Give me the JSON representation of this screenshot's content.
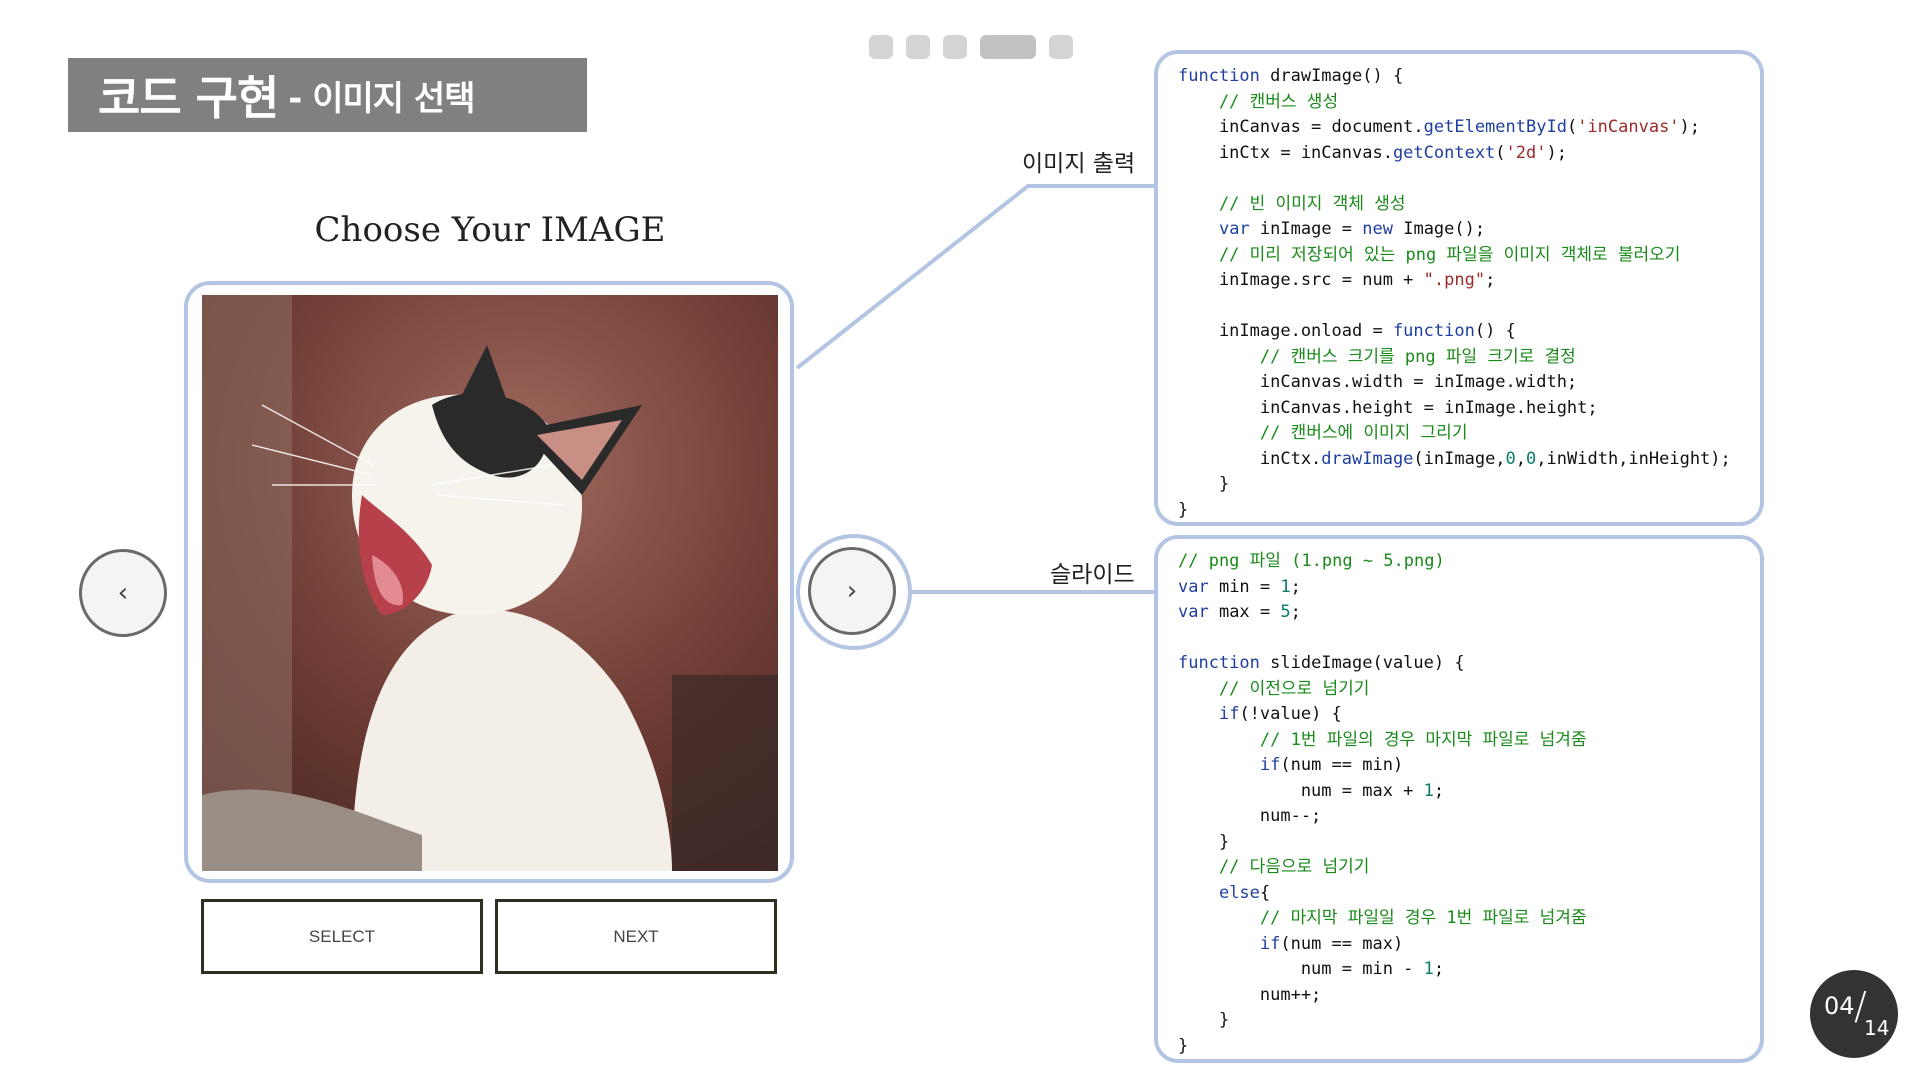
{
  "header": {
    "title_main": "코드 구현",
    "title_sub": "- 이미지 선택"
  },
  "pager": {
    "total_dots": 5,
    "active_index": 3
  },
  "viewer": {
    "heading": "Choose Your IMAGE",
    "prev_symbol": "‹",
    "next_symbol": "›",
    "select_label": "SELECT",
    "next_label": "NEXT"
  },
  "connectors": {
    "output_label": "이미지 출력",
    "slide_label": "슬라이드"
  },
  "code_top": [
    [
      {
        "t": "function",
        "c": "kw"
      },
      {
        "t": " drawImage() {",
        "c": ""
      }
    ],
    [
      {
        "t": "    // 캔버스 생성",
        "c": "cmt"
      }
    ],
    [
      {
        "t": "    inCanvas = document.",
        "c": ""
      },
      {
        "t": "getElementById",
        "c": "fn"
      },
      {
        "t": "(",
        "c": ""
      },
      {
        "t": "'inCanvas'",
        "c": "str"
      },
      {
        "t": ");",
        "c": ""
      }
    ],
    [
      {
        "t": "    inCtx = inCanvas.",
        "c": ""
      },
      {
        "t": "getContext",
        "c": "fn"
      },
      {
        "t": "(",
        "c": ""
      },
      {
        "t": "'2d'",
        "c": "str"
      },
      {
        "t": ");",
        "c": ""
      }
    ],
    [
      {
        "t": "",
        "c": ""
      }
    ],
    [
      {
        "t": "    // 빈 이미지 객체 생성",
        "c": "cmt"
      }
    ],
    [
      {
        "t": "    ",
        "c": ""
      },
      {
        "t": "var",
        "c": "kw"
      },
      {
        "t": " inImage = ",
        "c": ""
      },
      {
        "t": "new",
        "c": "kw"
      },
      {
        "t": " Image();",
        "c": ""
      }
    ],
    [
      {
        "t": "    // 미리 저장되어 있는 png 파일을 이미지 객체로 불러오기",
        "c": "cmt"
      }
    ],
    [
      {
        "t": "    inImage.src = num + ",
        "c": ""
      },
      {
        "t": "\".png\"",
        "c": "str"
      },
      {
        "t": ";",
        "c": ""
      }
    ],
    [
      {
        "t": "",
        "c": ""
      }
    ],
    [
      {
        "t": "    inImage.onload = ",
        "c": ""
      },
      {
        "t": "function",
        "c": "kw"
      },
      {
        "t": "() {",
        "c": ""
      }
    ],
    [
      {
        "t": "        // 캔버스 크기를 png 파일 크기로 결정",
        "c": "cmt"
      }
    ],
    [
      {
        "t": "        inCanvas.width = inImage.width;",
        "c": ""
      }
    ],
    [
      {
        "t": "        inCanvas.height = inImage.height;",
        "c": ""
      }
    ],
    [
      {
        "t": "        // 캔버스에 이미지 그리기",
        "c": "cmt"
      }
    ],
    [
      {
        "t": "        inCtx.",
        "c": ""
      },
      {
        "t": "drawImage",
        "c": "fn"
      },
      {
        "t": "(inImage,",
        "c": ""
      },
      {
        "t": "0",
        "c": "num"
      },
      {
        "t": ",",
        "c": ""
      },
      {
        "t": "0",
        "c": "num"
      },
      {
        "t": ",inWidth,inHeight);",
        "c": ""
      }
    ],
    [
      {
        "t": "    }",
        "c": ""
      }
    ],
    [
      {
        "t": "}",
        "c": ""
      }
    ]
  ],
  "code_bottom": [
    [
      {
        "t": "// png 파일 (1.png ~ 5.png)",
        "c": "cmt"
      }
    ],
    [
      {
        "t": "var",
        "c": "kw"
      },
      {
        "t": " min = ",
        "c": ""
      },
      {
        "t": "1",
        "c": "num"
      },
      {
        "t": ";",
        "c": ""
      }
    ],
    [
      {
        "t": "var",
        "c": "kw"
      },
      {
        "t": " max = ",
        "c": ""
      },
      {
        "t": "5",
        "c": "num"
      },
      {
        "t": ";",
        "c": ""
      }
    ],
    [
      {
        "t": "",
        "c": ""
      }
    ],
    [
      {
        "t": "function",
        "c": "kw"
      },
      {
        "t": " slideImage(value) {",
        "c": ""
      }
    ],
    [
      {
        "t": "    // 이전으로 넘기기",
        "c": "cmt"
      }
    ],
    [
      {
        "t": "    ",
        "c": ""
      },
      {
        "t": "if",
        "c": "kw"
      },
      {
        "t": "(!value) {",
        "c": ""
      }
    ],
    [
      {
        "t": "        // 1번 파일의 경우 마지막 파일로 넘겨줌",
        "c": "cmt"
      }
    ],
    [
      {
        "t": "        ",
        "c": ""
      },
      {
        "t": "if",
        "c": "kw"
      },
      {
        "t": "(num == min)",
        "c": ""
      }
    ],
    [
      {
        "t": "            num = max + ",
        "c": ""
      },
      {
        "t": "1",
        "c": "num"
      },
      {
        "t": ";",
        "c": ""
      }
    ],
    [
      {
        "t": "        num--;",
        "c": ""
      }
    ],
    [
      {
        "t": "    }",
        "c": ""
      }
    ],
    [
      {
        "t": "    // 다음으로 넘기기",
        "c": "cmt"
      }
    ],
    [
      {
        "t": "    ",
        "c": ""
      },
      {
        "t": "else",
        "c": "kw"
      },
      {
        "t": "{",
        "c": ""
      }
    ],
    [
      {
        "t": "        // 마지막 파일일 경우 1번 파일로 넘겨줌",
        "c": "cmt"
      }
    ],
    [
      {
        "t": "        ",
        "c": ""
      },
      {
        "t": "if",
        "c": "kw"
      },
      {
        "t": "(num == max)",
        "c": ""
      }
    ],
    [
      {
        "t": "            num = min - ",
        "c": ""
      },
      {
        "t": "1",
        "c": "num"
      },
      {
        "t": ";",
        "c": ""
      }
    ],
    [
      {
        "t": "        num++;",
        "c": ""
      }
    ],
    [
      {
        "t": "    }",
        "c": ""
      }
    ],
    [
      {
        "t": "}",
        "c": ""
      }
    ]
  ],
  "page_counter": {
    "current": "04",
    "slash": "/",
    "total": "14"
  },
  "colors": {
    "frame_border": "#b3c5e3",
    "banner_bg": "#808080",
    "keyword": "#1f3fa0",
    "comment": "#1a8a1a",
    "string": "#9c2a2a"
  }
}
